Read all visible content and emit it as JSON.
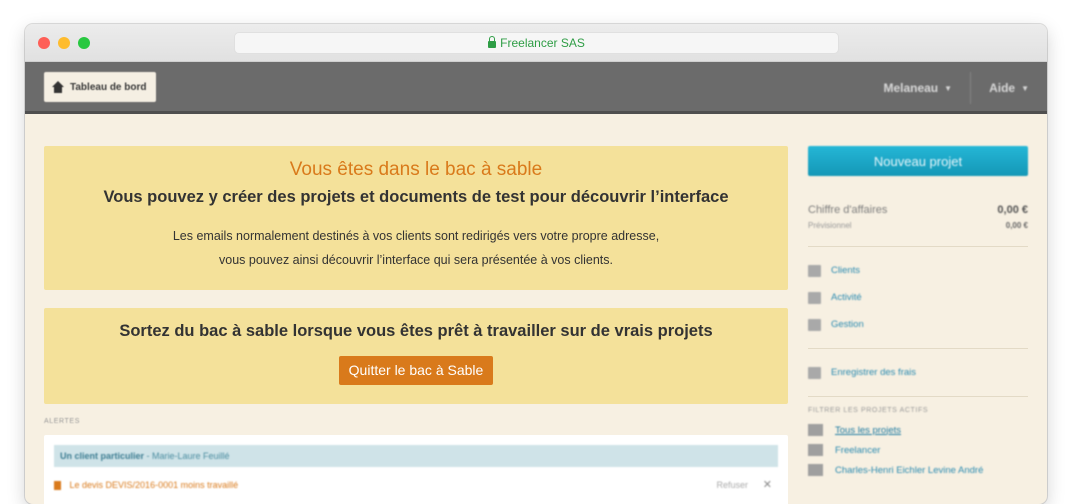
{
  "browser": {
    "url": "Freelancer SAS"
  },
  "navbar": {
    "home_label": "Tableau de bord",
    "user_label": "Melaneau",
    "help_label": "Aide"
  },
  "sandbox": {
    "title": "Vous êtes dans le bac à sable",
    "subtitle": "Vous pouvez y créer des projets et documents de test pour découvrir l’interface",
    "line1": "Les emails normalement destinés à vos clients sont redirigés vers votre propre adresse,",
    "line2": "vous pouvez ainsi découvrir l’interface qui sera présentée à vos clients."
  },
  "exit": {
    "title": "Sortez du bac à sable lorsque vous êtes prêt à travailler sur de vrais projets",
    "button_label": "Quitter le bac à Sable"
  },
  "alerts": {
    "label": "ALERTES",
    "head_client": "Un client particulier",
    "head_contact": " - Marie-Laure Feuillé",
    "row_text": "Le devis DEVIS/2016-0001 moins travaillé",
    "row_meta": "Refuser",
    "close_glyph": "✕"
  },
  "sidebar": {
    "new_project_label": "Nouveau projet",
    "revenue_label": "Chiffre d'affaires",
    "revenue_value": "0,00 €",
    "forecast_label": "Prévisionnel",
    "forecast_value": "0,00 €",
    "links": [
      {
        "label": "Clients",
        "icon": "users-icon"
      },
      {
        "label": "Activité",
        "icon": "chart-icon"
      },
      {
        "label": "Gestion",
        "icon": "briefcase-icon"
      }
    ],
    "expense_label": "Enregistrer des frais",
    "filter_label": "FILTRER LES PROJETS ACTIFS",
    "filters": [
      {
        "label": "Tous les projets"
      },
      {
        "label": "Freelancer"
      },
      {
        "label": "Charles-Henri Eichler Levine André"
      }
    ]
  },
  "colors": {
    "accent_orange": "#d97a1b",
    "panel_yellow": "#f4e19a",
    "navbar_gray": "#6b6b6b",
    "primary_blue": "#1ba7c6",
    "page_bg": "#f7f0e2"
  }
}
